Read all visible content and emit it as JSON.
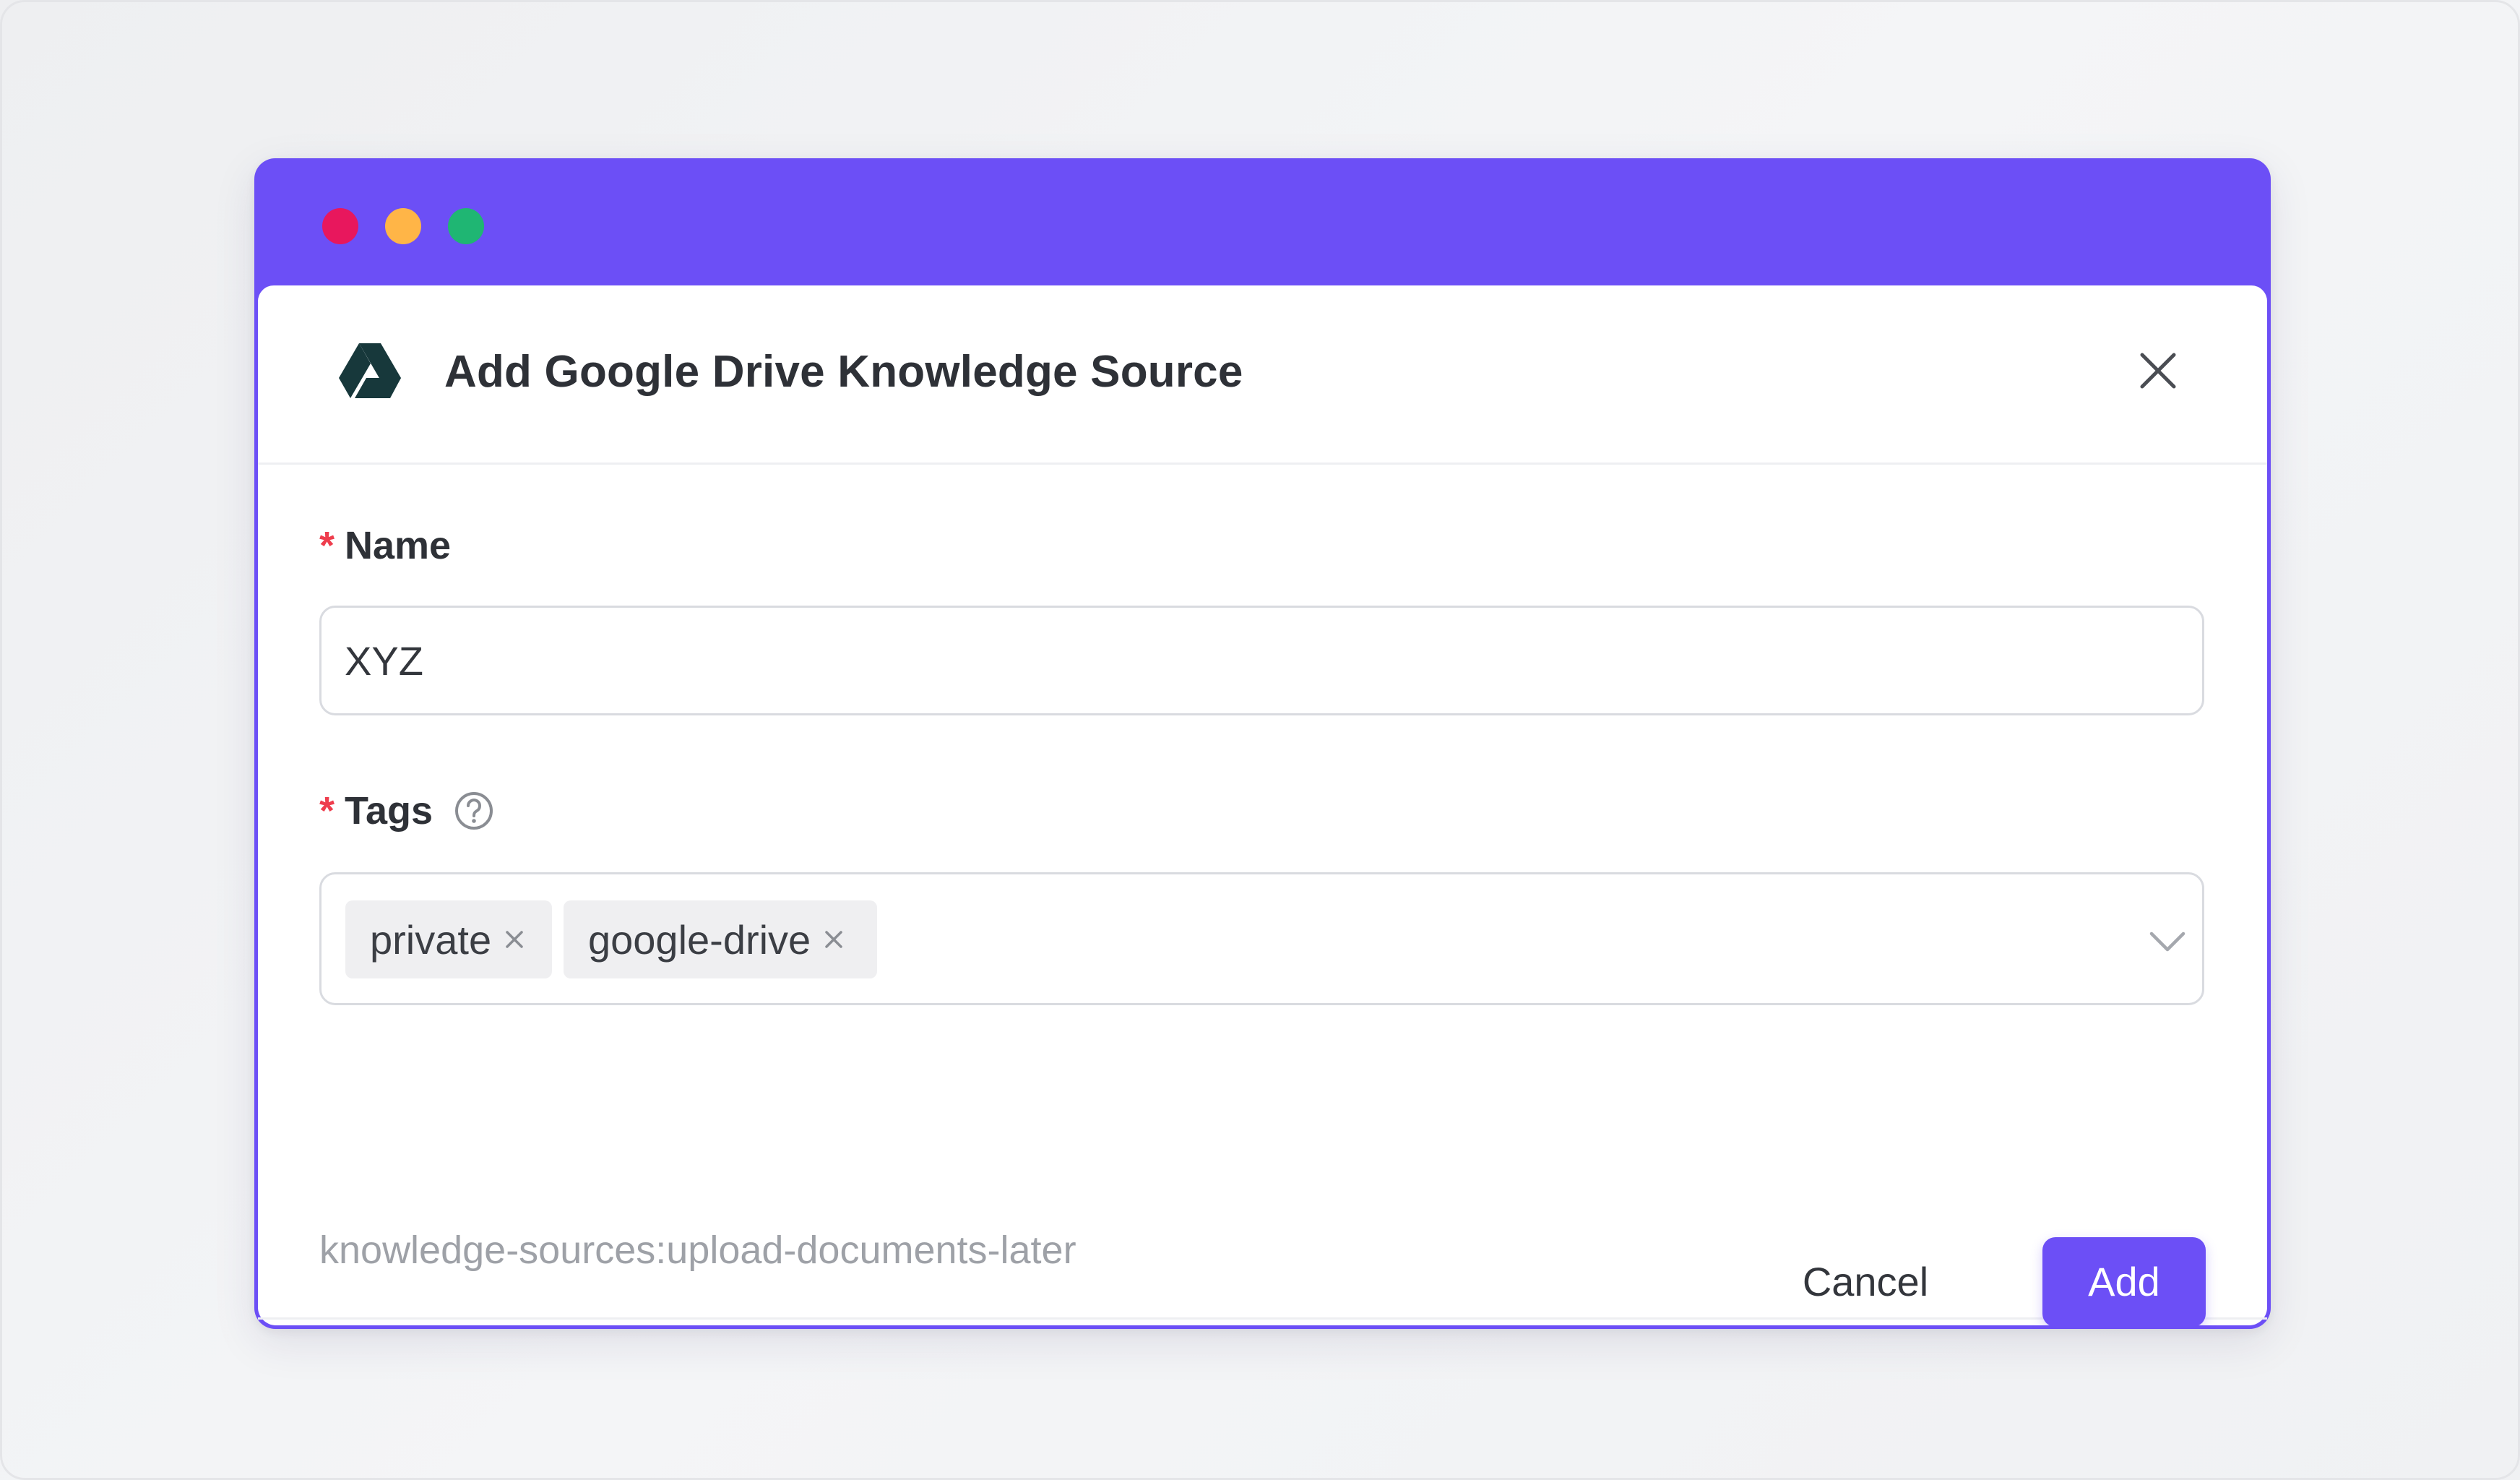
{
  "window": {
    "controls": [
      "close",
      "minimize",
      "maximize"
    ],
    "accent_color": "#6c4ff6"
  },
  "modal": {
    "title": "Add Google Drive Knowledge Source",
    "icon": "google-drive-icon",
    "close_icon": "close-icon"
  },
  "form": {
    "name": {
      "required_marker": "*",
      "label": "Name",
      "value": "XYZ"
    },
    "tags": {
      "required_marker": "*",
      "label": "Tags",
      "help_icon": "question-circle-icon",
      "items": [
        {
          "label": "private"
        },
        {
          "label": "google-drive"
        }
      ],
      "dropdown_icon": "chevron-down-icon"
    },
    "hint": "knowledge-sources:upload-documents-later"
  },
  "footer": {
    "cancel_label": "Cancel",
    "add_label": "Add"
  },
  "colors": {
    "required": "#ee3d4d",
    "primary": "#6c4ff6",
    "traffic_red": "#e8175d",
    "traffic_yellow": "#ffb547",
    "traffic_green": "#1fb673"
  }
}
